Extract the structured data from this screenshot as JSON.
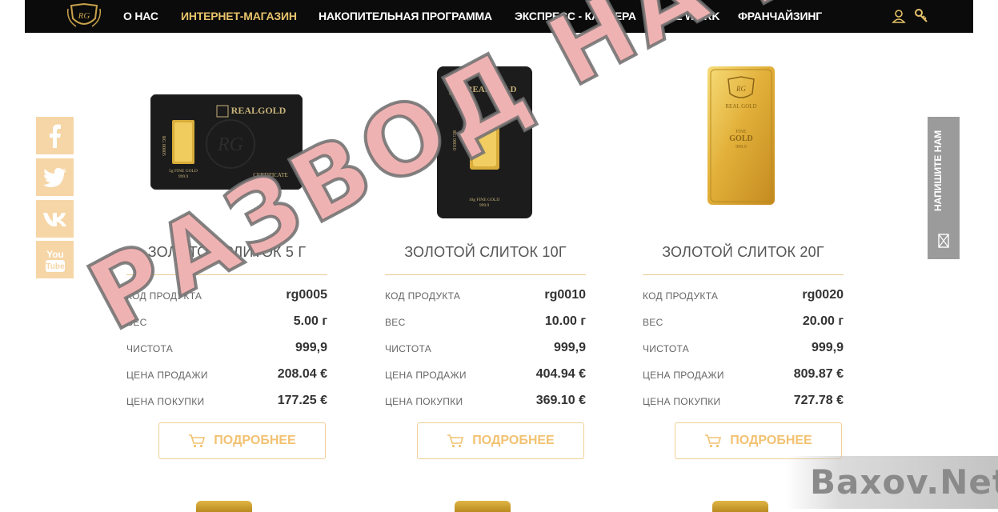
{
  "nav": {
    "items": [
      {
        "label": "О НАС",
        "active": false
      },
      {
        "label": "ИНТЕРНЕТ-МАГАЗИН",
        "active": true
      },
      {
        "label": "НАКОПИТЕЛЬНАЯ ПРОГРАММА",
        "active": false
      },
      {
        "label": "ЭКСПРЕСС - КАРЬЕРА",
        "active": false
      },
      {
        "label": "REAL WORK",
        "active": false
      },
      {
        "label": "ФРАНЧАЙЗИНГ",
        "active": false
      }
    ],
    "icons": [
      "user-icon",
      "key-icon"
    ],
    "accent": "#e7c36a"
  },
  "social": [
    {
      "name": "facebook-icon"
    },
    {
      "name": "twitter-icon"
    },
    {
      "name": "vk-icon",
      "text": "vk"
    },
    {
      "name": "youtube-icon",
      "text": "You Tube"
    }
  ],
  "contact_tab": {
    "label": "НАПИШИТЕ НАМ",
    "icon": "mail-icon"
  },
  "products": [
    {
      "title": "ЗОЛОТОЙ СЛИТОК 5 Г",
      "specs": [
        {
          "key": "КОД ПРОДУКТА",
          "value": "rg0005"
        },
        {
          "key": "ВЕС",
          "value": "5.00 г"
        },
        {
          "key": "ЧИСТОТА",
          "value": "999,9"
        },
        {
          "key": "ЦЕНА ПРОДАЖИ",
          "value": "208.04 €"
        },
        {
          "key": "ЦЕНА ПОКУПКИ",
          "value": "177.25 €"
        }
      ],
      "button": "ПОДРОБНЕЕ",
      "image": {
        "brand": "REALGOLD",
        "side_text": "RG 00005",
        "caption": "5g FINE GOLD",
        "caption2": "999.9",
        "cert": "CERTIFICATE"
      }
    },
    {
      "title": "ЗОЛОТОЙ СЛИТОК 10Г",
      "specs": [
        {
          "key": "КОД ПРОДУКТА",
          "value": "rg0010"
        },
        {
          "key": "ВЕС",
          "value": "10.00 г"
        },
        {
          "key": "ЧИСТОТА",
          "value": "999,9"
        },
        {
          "key": "ЦЕНА ПРОДАЖИ",
          "value": "404.94 €"
        },
        {
          "key": "ЦЕНА ПОКУПКИ",
          "value": "369.10 €"
        }
      ],
      "button": "ПОДРОБНЕЕ",
      "image": {
        "brand": "REALGOLD",
        "side_text": "RG 00010",
        "caption": "10g FINE GOLD",
        "caption2": "999.9"
      }
    },
    {
      "title": "ЗОЛОТОЙ СЛИТОК 20Г",
      "specs": [
        {
          "key": "КОД ПРОДУКТА",
          "value": "rg0020"
        },
        {
          "key": "ВЕС",
          "value": "20.00 г"
        },
        {
          "key": "ЧИСТОТА",
          "value": "999,9"
        },
        {
          "key": "ЦЕНА ПРОДАЖИ",
          "value": "809.87 €"
        },
        {
          "key": "ЦЕНА ПОКУПКИ",
          "value": "727.78 €"
        }
      ],
      "button": "ПОДРОБНЕЕ",
      "image": {
        "brand": "REAL GOLD",
        "caption": "FINE",
        "caption2": "GOLD",
        "caption3": "999.9"
      }
    }
  ],
  "stamp": "РАЗВОД НА ДЕНЬГИ",
  "watermark": "Baxov.Net"
}
